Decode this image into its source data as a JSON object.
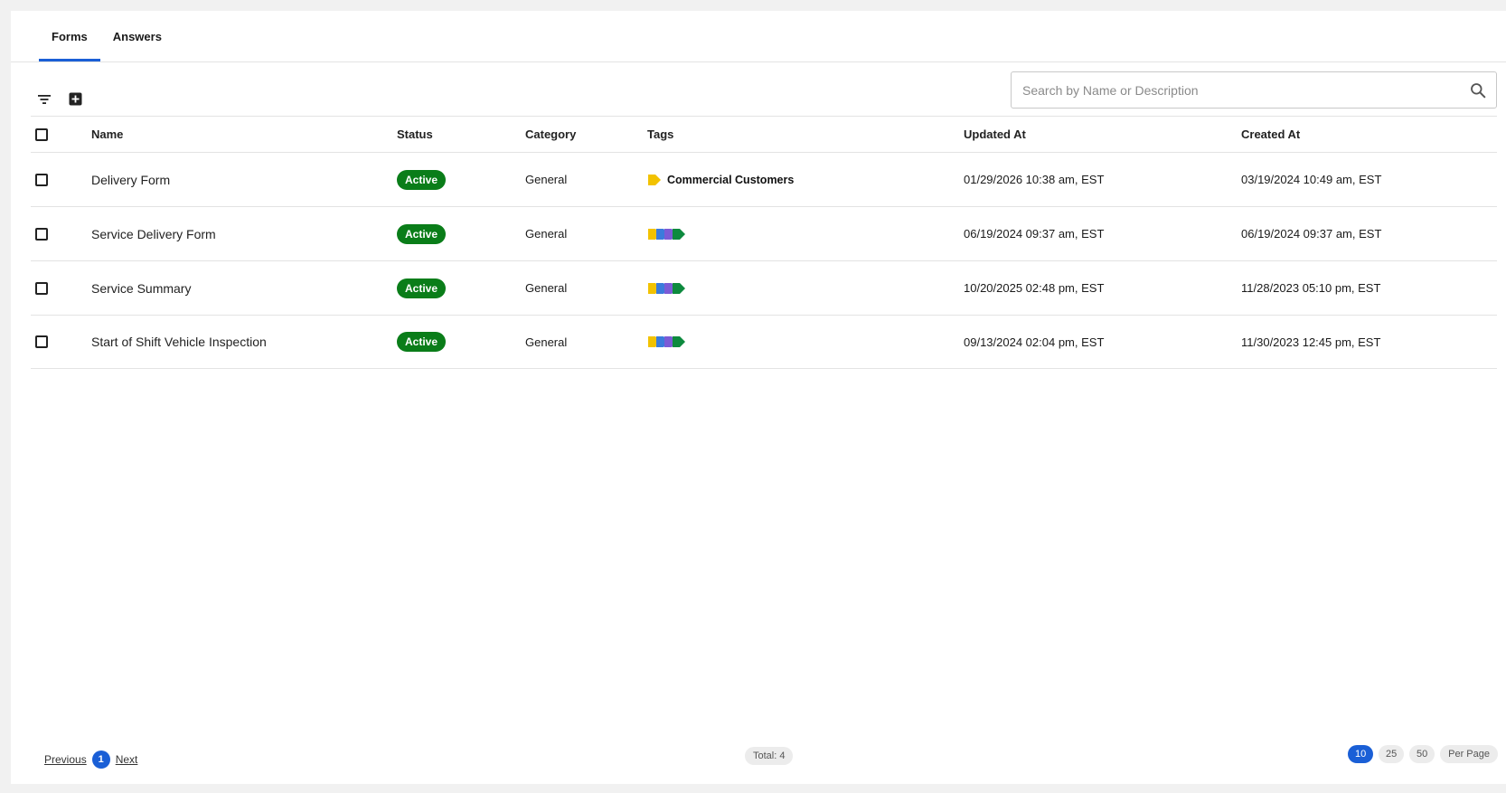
{
  "tabs": [
    {
      "label": "Forms",
      "active": true
    },
    {
      "label": "Answers",
      "active": false
    }
  ],
  "toolbar": {
    "filter_icon": "filter-icon",
    "add_icon": "add-box-icon"
  },
  "search": {
    "placeholder": "Search by Name or Description",
    "value": ""
  },
  "table": {
    "headers": {
      "name": "Name",
      "status": "Status",
      "category": "Category",
      "tags": "Tags",
      "updated_at": "Updated At",
      "created_at": "Created At"
    },
    "rows": [
      {
        "name": "Delivery Form",
        "status": "Active",
        "category": "General",
        "tag_label": "Commercial Customers",
        "updated_at": "01/29/2026 10:38 am, EST",
        "created_at": "03/19/2024 10:49 am, EST"
      },
      {
        "name": "Service Delivery Form",
        "status": "Active",
        "category": "General",
        "tag_label": "",
        "updated_at": "06/19/2024 09:37 am, EST",
        "created_at": "06/19/2024 09:37 am, EST"
      },
      {
        "name": "Service Summary",
        "status": "Active",
        "category": "General",
        "tag_label": "",
        "updated_at": "10/20/2025 02:48 pm, EST",
        "created_at": "11/28/2023 05:10 pm, EST"
      },
      {
        "name": "Start of Shift Vehicle Inspection",
        "status": "Active",
        "category": "General",
        "tag_label": "",
        "updated_at": "09/13/2024 02:04 pm, EST",
        "created_at": "11/30/2023 12:45 pm, EST"
      }
    ]
  },
  "tag_colors": [
    "#f2c200",
    "#3b7bdc",
    "#7b5bd6",
    "#0d8a3e"
  ],
  "colors": {
    "accent": "#1a5fd6",
    "status_active": "#0a7d19"
  },
  "pagination": {
    "previous": "Previous",
    "current_page": "1",
    "next": "Next",
    "total": "Total: 4",
    "per_page_options": [
      "10",
      "25",
      "50"
    ],
    "per_page_selected": "10",
    "per_page_label": "Per Page"
  }
}
